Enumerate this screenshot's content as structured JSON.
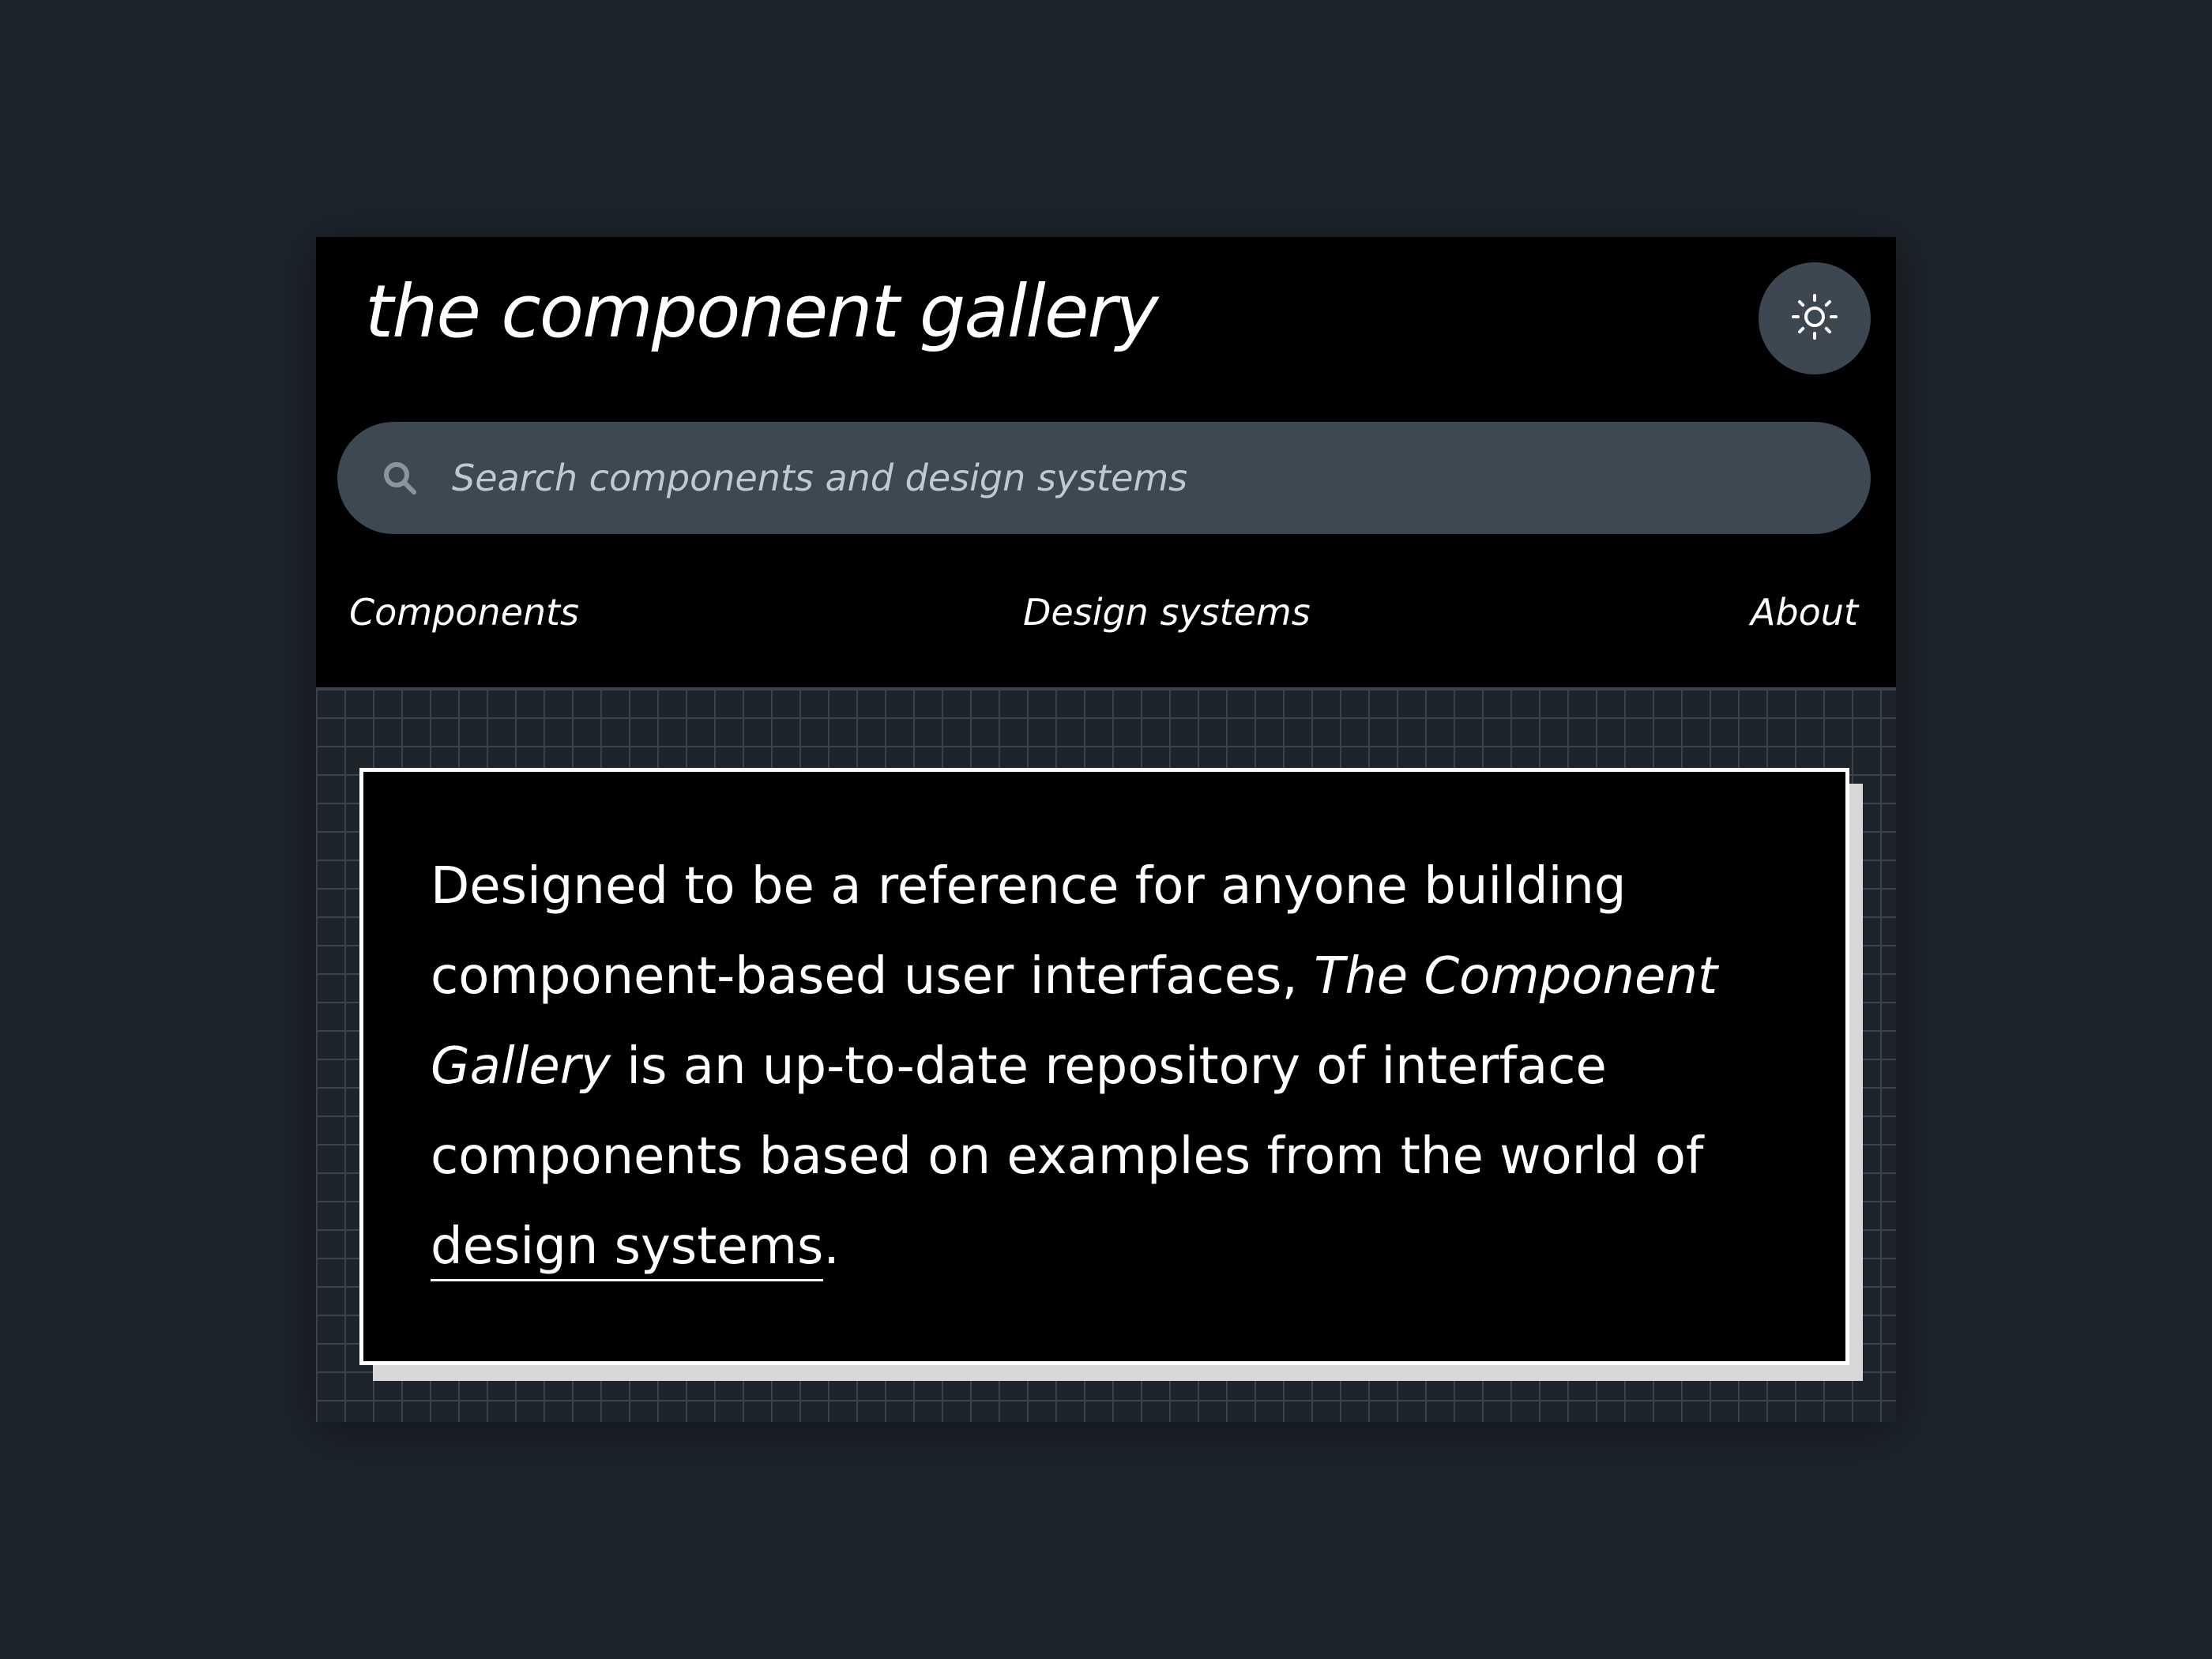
{
  "header": {
    "site_title": "the component gallery",
    "theme_toggle_icon": "sun-icon"
  },
  "search": {
    "placeholder": "Search components and design systems",
    "value": "",
    "icon": "search-icon"
  },
  "nav": {
    "items": [
      {
        "label": "Components"
      },
      {
        "label": "Design systems"
      },
      {
        "label": "About"
      }
    ]
  },
  "intro": {
    "text_before": "Designed to be a reference for anyone building component-based user interfaces, ",
    "emphasis": "The Component Gallery",
    "text_after": " is an up-to-date repository of interface components based on examples from the world of ",
    "link_label": "design systems",
    "text_end": "."
  },
  "colors": {
    "page_background": "#1e242c",
    "window_background": "#000000",
    "search_background": "#3e4852",
    "toggle_background": "#3d4752",
    "text": "#ffffff",
    "grid_line": "#3b434c"
  }
}
